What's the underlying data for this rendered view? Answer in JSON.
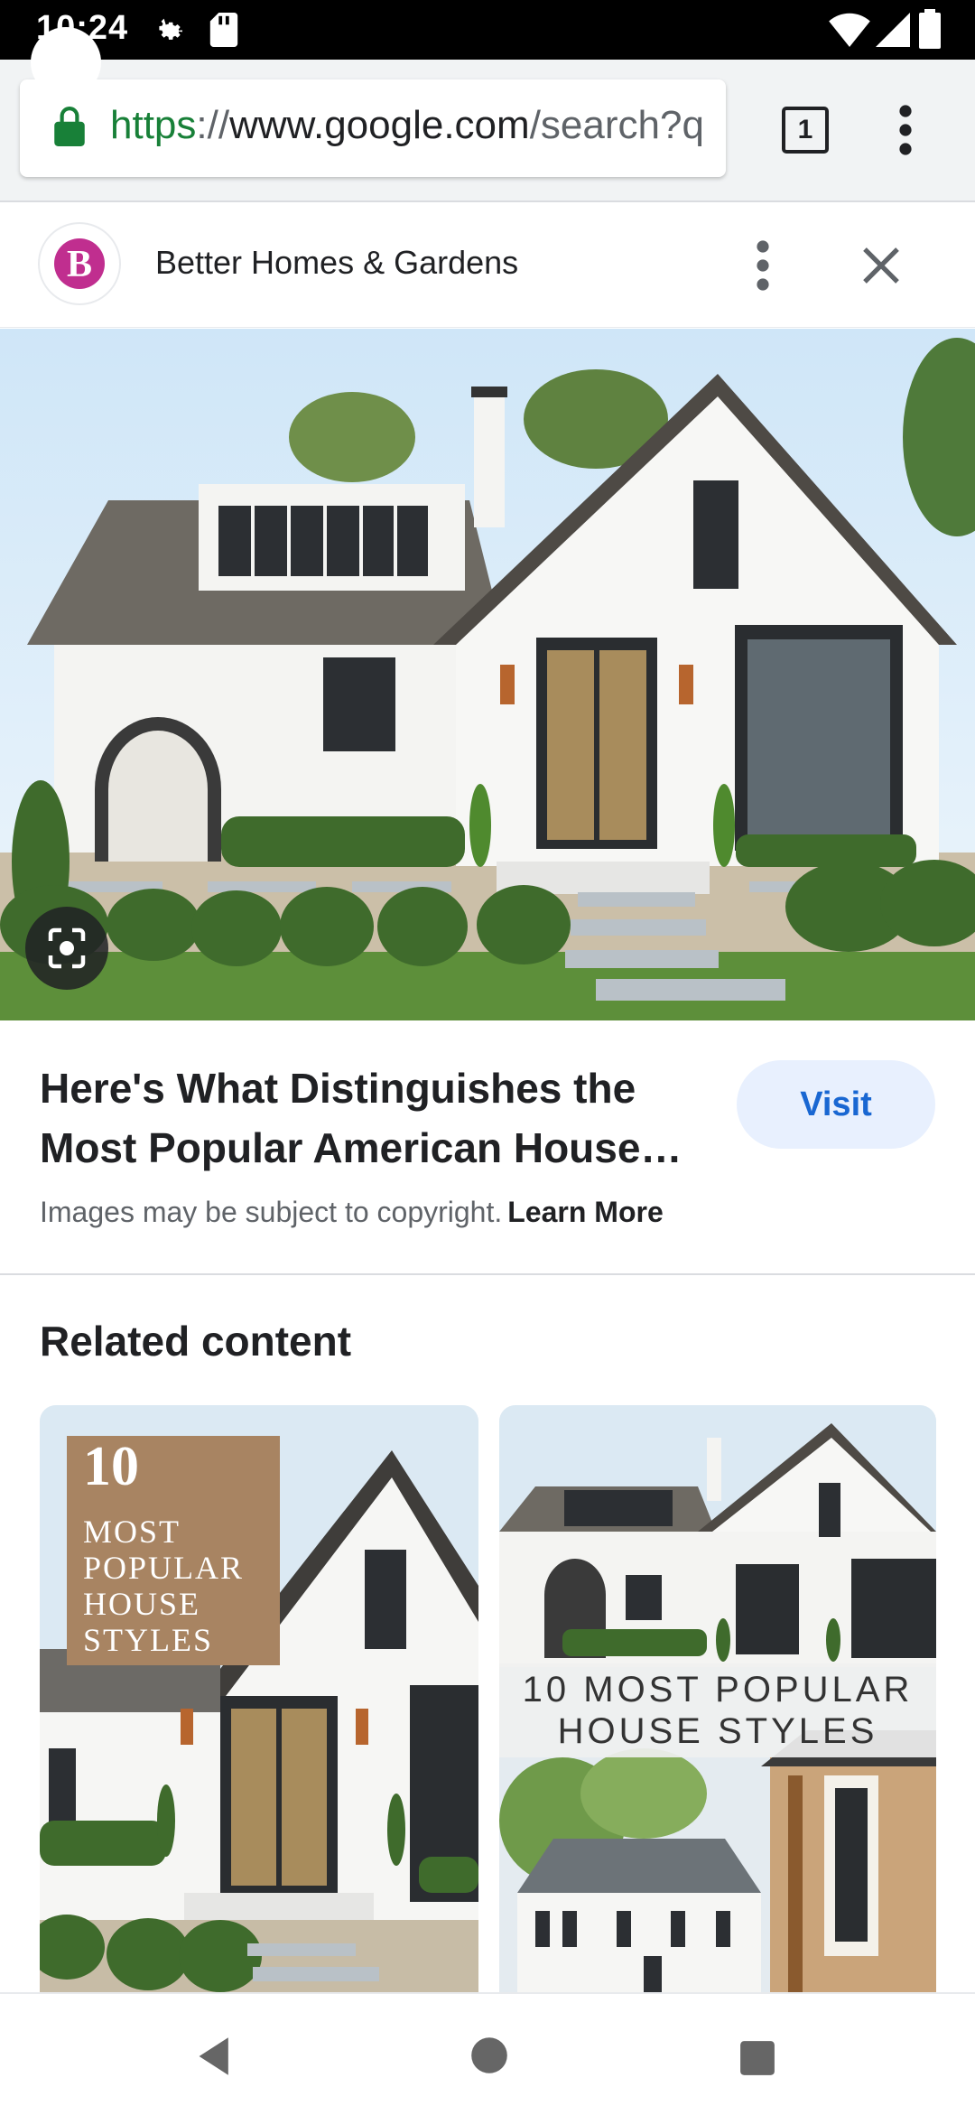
{
  "status_bar": {
    "time": "10:24"
  },
  "browser": {
    "url_scheme": "https",
    "url_sep": "://",
    "url_host": "www.google.com",
    "url_path": "/search?q",
    "tab_count": "1"
  },
  "source": {
    "logo_letter": "B",
    "name": "Better Homes & Gardens"
  },
  "result": {
    "title": "Here's What Distinguishes the Most Popular American House…",
    "visit_label": "Visit",
    "copyright_text": "Images may be subject to copyright.",
    "learn_more": "Learn More"
  },
  "related": {
    "title": "Related content",
    "items": [
      {
        "number": "10",
        "words": "MOST POPULAR HOUSE STYLES"
      },
      {
        "banner": "10 MOST POPULAR HOUSE STYLES"
      }
    ]
  },
  "colors": {
    "accent": "#1967d2",
    "visit_bg": "#e8f0fe",
    "secure_green": "#188038",
    "logo_magenta": "#c02e8f"
  },
  "icons": {
    "status": [
      "gear-icon",
      "sd-card-icon",
      "wifi-icon",
      "signal-icon",
      "battery-icon"
    ],
    "toolbar": [
      "lock-icon",
      "tab-switcher-icon",
      "more-vert-icon"
    ],
    "source": [
      "more-vert-icon",
      "close-icon"
    ],
    "image": [
      "lens-icon"
    ],
    "nav": [
      "back-icon",
      "home-icon",
      "recents-icon"
    ]
  }
}
